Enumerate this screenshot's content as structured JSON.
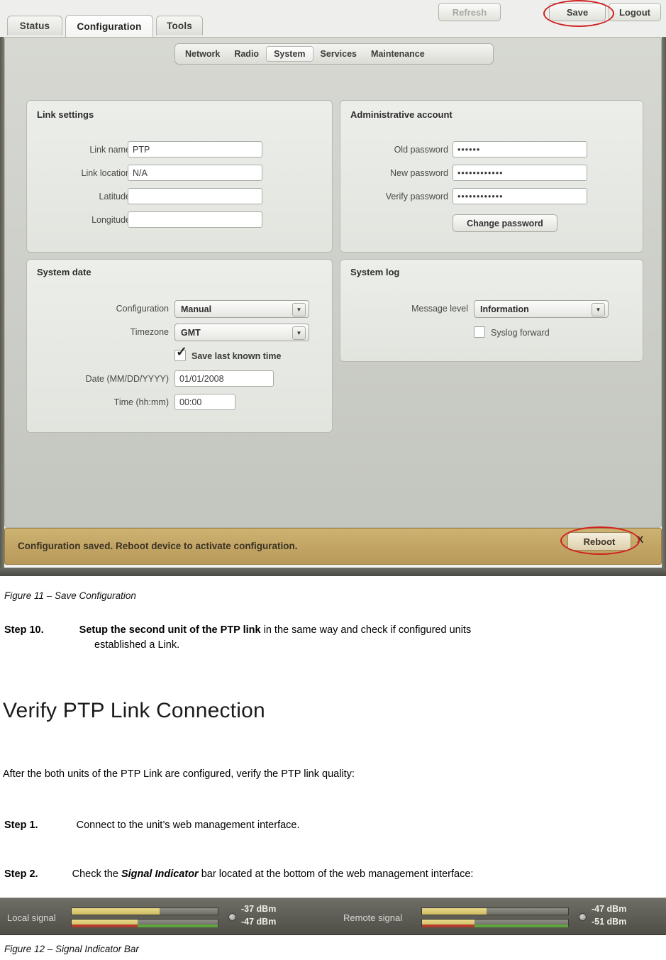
{
  "figure11": {
    "top_nav": {
      "tabs": [
        {
          "label": "Status",
          "active": false
        },
        {
          "label": "Configuration",
          "active": true
        },
        {
          "label": "Tools",
          "active": false
        }
      ],
      "buttons": {
        "refresh": "Refresh",
        "save": "Save",
        "logout": "Logout"
      }
    },
    "sub_nav": {
      "tabs": [
        {
          "label": "Network",
          "active": false
        },
        {
          "label": "Radio",
          "active": false
        },
        {
          "label": "System",
          "active": true
        },
        {
          "label": "Services",
          "active": false
        },
        {
          "label": "Maintenance",
          "active": false
        }
      ]
    },
    "link_settings": {
      "title": "Link settings",
      "fields": [
        {
          "label": "Link name",
          "value": "PTP"
        },
        {
          "label": "Link location",
          "value": "N/A"
        },
        {
          "label": "Latitude",
          "value": ""
        },
        {
          "label": "Longitude",
          "value": ""
        }
      ]
    },
    "administrative_account": {
      "title": "Administrative account",
      "fields": [
        {
          "label": "Old password",
          "value": "••••••"
        },
        {
          "label": "New password",
          "value": "••••••••••••"
        },
        {
          "label": "Verify password",
          "value": "••••••••••••"
        }
      ],
      "change_button": "Change password"
    },
    "system_date": {
      "title": "System date",
      "configuration_label": "Configuration",
      "configuration_value": "Manual",
      "timezone_label": "Timezone",
      "timezone_value": "GMT",
      "save_last_known_time_label": "Save last known time",
      "save_last_known_time_checked": true,
      "date_label": "Date (MM/DD/YYYY)",
      "date_value": "01/01/2008",
      "time_label": "Time (hh:mm)",
      "time_value": "00:00"
    },
    "system_log": {
      "title": "System log",
      "message_level_label": "Message level",
      "message_level_value": "Information",
      "syslog_forward_label": "Syslog forward",
      "syslog_forward_checked": false
    },
    "status_bar": {
      "message": "Configuration saved. Reboot device to activate configuration.",
      "reboot_button": "Reboot",
      "close_label": "X"
    }
  },
  "doc": {
    "fig11_caption": "Figure 11 – Save Configuration",
    "step10": {
      "label": "Step 10.",
      "bold_part": "Setup the second unit of the PTP link",
      "rest": " in the same way and check if configured units",
      "line2": "established a Link."
    },
    "heading": "Verify PTP Link Connection",
    "intro": "After the both units of the PTP Link are configured, verify the PTP link quality:",
    "step1": {
      "label": "Step 1.",
      "text": "Connect to the unit’s web management interface."
    },
    "step2": {
      "label": "Step 2.",
      "pre": "Check the ",
      "bold_italic": "Signal Indicator",
      "post": " bar located at the bottom of the web management interface:"
    },
    "fig12_caption": "Figure 12 – Signal Indicator Bar"
  },
  "figure12": {
    "local": {
      "label": "Local signal",
      "value_top": "-37 dBm",
      "value_bottom": "-47 dBm",
      "bar_top_percent": 60,
      "bar_bottom_percent": 45
    },
    "remote": {
      "label": "Remote signal",
      "value_top": "-47 dBm",
      "value_bottom": "-51 dBm",
      "bar_top_percent": 44,
      "bar_bottom_percent": 36
    },
    "colors": {
      "fill": "#ddcb6f",
      "green": "#5fa53c",
      "red": "#b53a2c"
    }
  }
}
